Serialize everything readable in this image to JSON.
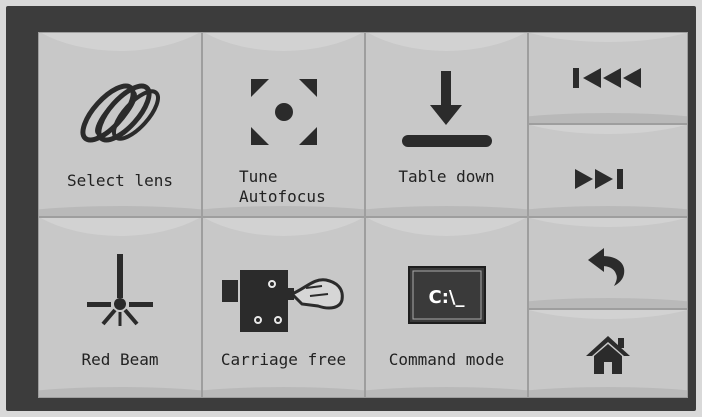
{
  "buttons": {
    "select_lens": "Select lens",
    "tune_autofocus_line1": "Tune",
    "tune_autofocus_line2": "Autofocus",
    "table_down": "Table down",
    "red_beam": "Red Beam",
    "carriage_free": "Carriage free",
    "command_mode": "Command mode",
    "command_icon_text": "C:\\_"
  },
  "icons": {
    "select_lens": "lens-rings-icon",
    "tune_autofocus": "focus-target-icon",
    "table_down": "arrow-down-to-bar-icon",
    "red_beam": "laser-beam-icon",
    "carriage_free": "hand-carriage-icon",
    "command_mode": "terminal-icon",
    "first": "rewind-to-start-icon",
    "last": "fast-forward-to-end-icon",
    "back": "undo-arrow-icon",
    "home": "home-icon"
  },
  "colors": {
    "frame": "#3c3c3c",
    "tile": "#c8c8c8",
    "icon": "#2b2b2b"
  }
}
